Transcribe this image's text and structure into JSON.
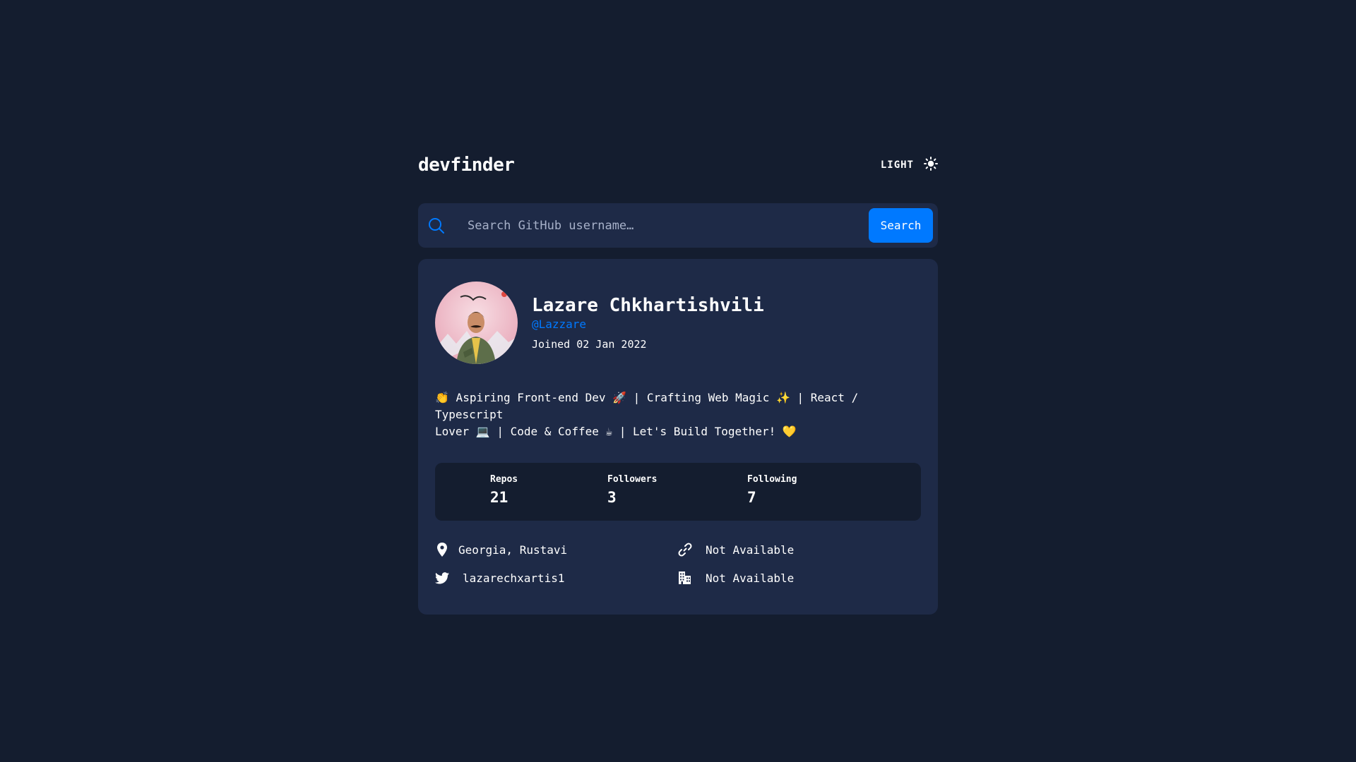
{
  "header": {
    "logo": "devfinder",
    "theme_label": "LIGHT",
    "theme_icon": "sun-icon"
  },
  "search": {
    "placeholder": "Search GitHub username…",
    "value": "",
    "button_label": "Search",
    "icon": "search-icon"
  },
  "profile": {
    "name": "Lazare Chkhartishvili",
    "login": "@Lazzare",
    "joined": "Joined 02 Jan 2022",
    "bio_line1": "👏 Aspiring Front-end Dev 🚀 | Crafting Web Magic ✨ | React / Typescript",
    "bio_line2": "Lover 💻 | Code & Coffee ☕ | Let's Build Together! 💛"
  },
  "stats": {
    "repos_label": "Repos",
    "repos_value": "21",
    "followers_label": "Followers",
    "followers_value": "3",
    "following_label": "Following",
    "following_value": "7"
  },
  "links": {
    "location": "Georgia, Rustavi",
    "blog": "Not Available",
    "twitter": "lazarechxartis1",
    "company": "Not Available"
  },
  "colors": {
    "background": "#141d2f",
    "card": "#1e2a47",
    "accent": "#0079ff",
    "text": "#ffffff",
    "placeholder": "#a7b1c9"
  }
}
